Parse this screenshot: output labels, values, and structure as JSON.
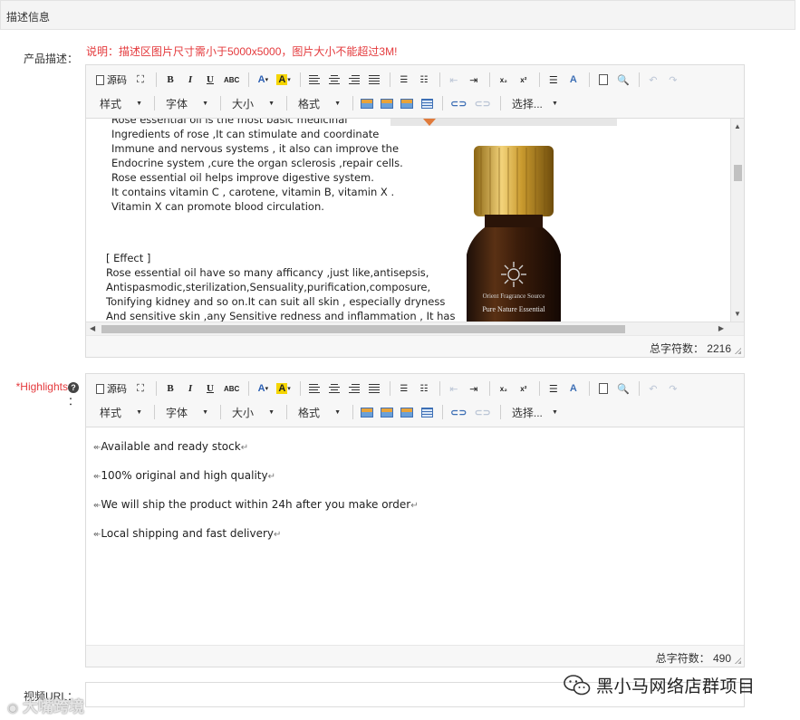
{
  "section": {
    "title": "描述信息"
  },
  "product_desc": {
    "label": "产品描述：",
    "note": "说明：描述区图片尺寸需小于5000x5000，图片大小不能超过3M!",
    "lines": [
      "Rose essential oil is the most basic medicinal",
      "Ingredients of rose ,It can stimulate and coordinate",
      "Immune and nervous systems , it also can improve the",
      "Endocrine system ,cure the organ sclerosis ,repair cells.",
      "Rose essential oil helps improve digestive system.",
      "It contains vitamin C , carotene, vitamin B, vitamin X .",
      "Vitamin X can promote blood circulation."
    ],
    "effect_lines": [
      "[ Effect ]",
      "Rose essential oil have so many afficancy ,just like,antisepsis,",
      "Antispasmodic,sterilization,Sensuality,purification,composure,",
      "Tonifying kidney and so on.It can suit all skin ,  especially dryness",
      "And sensitive skin ,any Sensitive redness and inflammation , It has"
    ],
    "bottle_label_1": "Orient Fragrance Source",
    "bottle_label_2": "Pure Nature Essential",
    "char_count_label": "总字符数：",
    "char_count": "2216"
  },
  "highlights": {
    "label": "*Highlights",
    "label_colon": "：",
    "items": [
      "Available and ready stock",
      "100% original and high quality",
      "We will ship the product within 24h after you make order",
      "Local shipping and fast delivery"
    ],
    "char_count_label": "总字符数：",
    "char_count": "490"
  },
  "toolbar": {
    "source": "源码",
    "bold": "B",
    "italic": "I",
    "underline": "U",
    "strike": "ABC",
    "font_color": "A",
    "highlight": "A",
    "subscript": "x₂",
    "superscript": "x²",
    "style": "样式",
    "font": "字体",
    "size": "大小",
    "format": "格式",
    "choose": "选择..."
  },
  "video": {
    "label": "视频URL：",
    "value": ""
  },
  "watermarks": {
    "right": "黑小马网络店群项目",
    "left": "大嘴跨境"
  },
  "icons": [
    "source-icon",
    "fullscreen-icon",
    "align-left-icon",
    "align-center-icon",
    "align-right-icon",
    "justify-icon",
    "bullet-list-icon",
    "numbered-list-icon",
    "outdent-icon",
    "indent-icon",
    "horizontal-rule-icon",
    "clear-format-icon",
    "new-doc-icon",
    "preview-icon",
    "undo-icon",
    "redo-icon",
    "paste-icon",
    "paste-text-icon",
    "paste-word-icon",
    "table-icon",
    "link-icon",
    "unlink-icon",
    "help-icon",
    "wechat-icon"
  ]
}
